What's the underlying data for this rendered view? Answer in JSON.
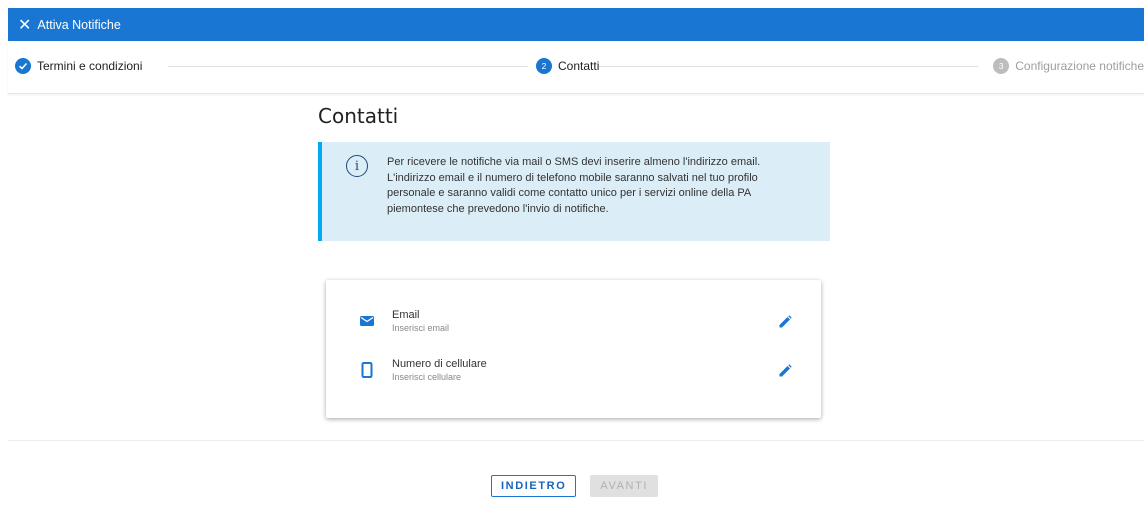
{
  "titlebar": {
    "close_icon": "close-icon",
    "title": "Attiva Notifiche"
  },
  "stepper": {
    "steps": [
      {
        "number": "",
        "label": "Termini e condizioni",
        "state": "completed",
        "icon": "check-circle-icon"
      },
      {
        "number": "2",
        "label": "Contatti",
        "state": "active"
      },
      {
        "number": "3",
        "label": "Configurazione notifiche",
        "state": "pending"
      }
    ]
  },
  "main": {
    "title": "Contatti",
    "info": {
      "icon": "info-icon",
      "text": "Per ricevere le notifiche via mail o SMS devi inserire almeno l'indirizzo email. L'indirizzo email e il numero di telefono mobile saranno salvati nel tuo profilo personale e saranno validi come contatto unico per i servizi online della PA piemontese che prevedono l'invio di notifiche."
    },
    "contacts": [
      {
        "icon": "mail-icon",
        "label": "Email",
        "value": "Inserisci email",
        "action_icon": "pencil-icon"
      },
      {
        "icon": "phone-icon",
        "label": "Numero di cellulare",
        "value": "Inserisci cellulare",
        "action_icon": "pencil-icon"
      }
    ]
  },
  "actions": {
    "back_label": "INDIETRO",
    "next_label": "AVANTI",
    "next_disabled": true
  },
  "colors": {
    "primary": "#1976d2",
    "info_bg": "#dbedf6",
    "info_border": "#03a9f4",
    "disabled_bg": "#e0e0e0"
  }
}
